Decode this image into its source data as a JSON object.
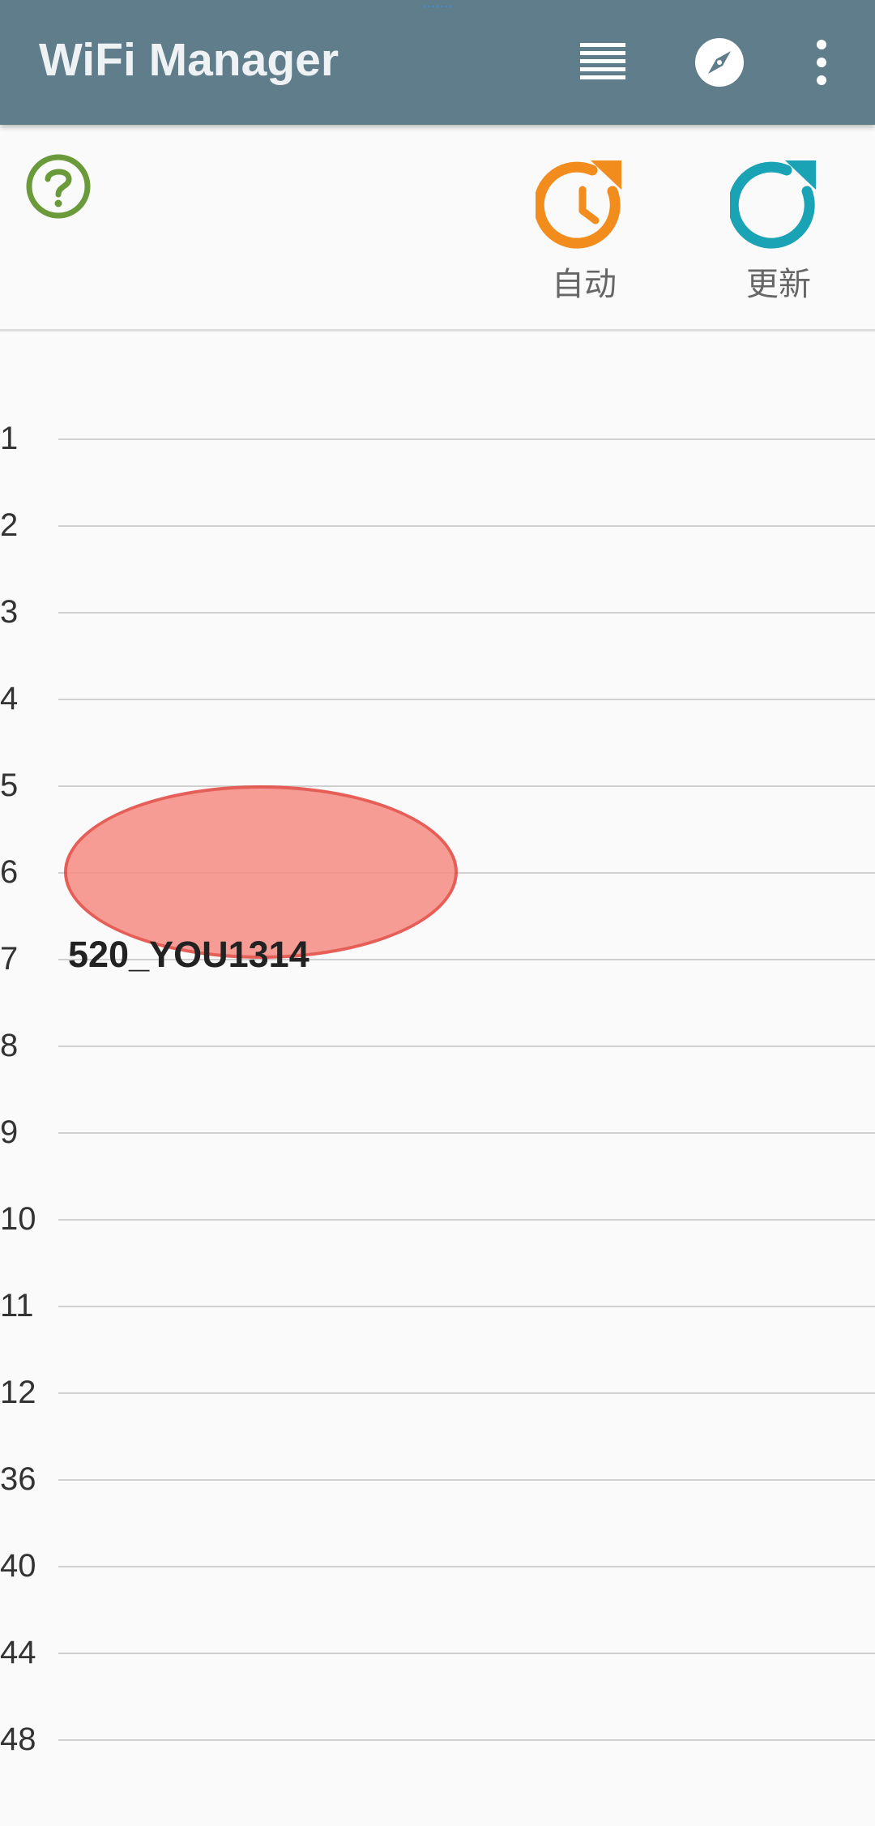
{
  "status_bar": {
    "center_text": "·······"
  },
  "appbar": {
    "title": "WiFi Manager",
    "actions": [
      {
        "name": "list-view-icon"
      },
      {
        "name": "compass-icon"
      },
      {
        "name": "overflow-menu-icon"
      }
    ],
    "color": "#607d8b"
  },
  "toolbar": {
    "help_icon": "help-circle-icon",
    "auto_label": "自动",
    "refresh_label": "更新",
    "colors": {
      "help": "#6a9a3a",
      "auto": "#f28c1c",
      "refresh": "#1aa3b5"
    }
  },
  "graph": {
    "channels": [
      "1",
      "2",
      "3",
      "4",
      "5",
      "6",
      "7",
      "8",
      "9",
      "10",
      "11",
      "12",
      "36",
      "40",
      "44",
      "48"
    ],
    "networks": [
      {
        "ssid": "520_YOU1314",
        "channel": 6,
        "color": "#f78c83",
        "border": "#e2443c"
      }
    ]
  }
}
